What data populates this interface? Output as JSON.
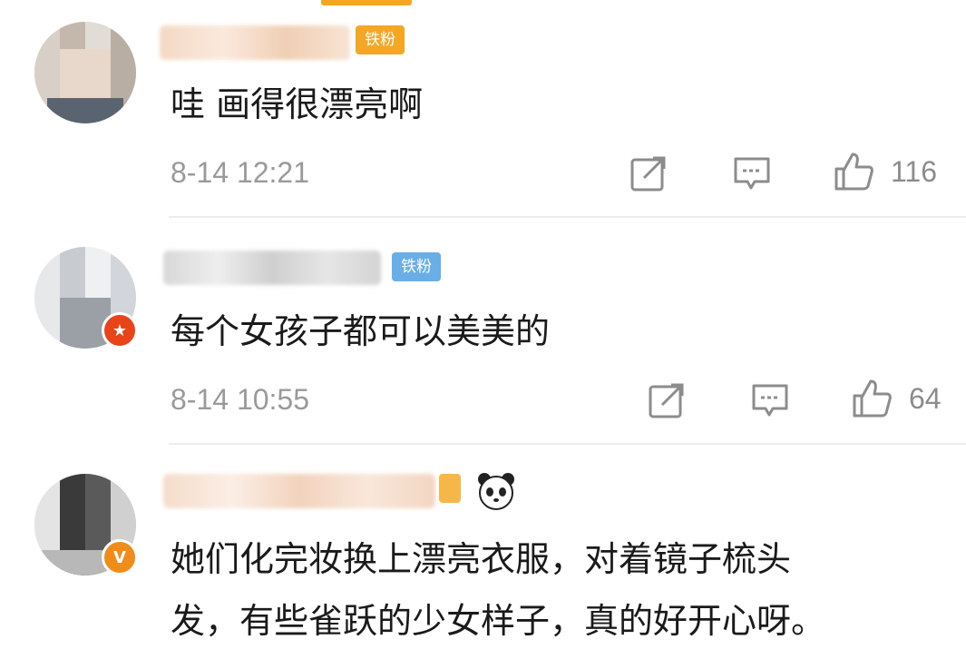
{
  "comments": [
    {
      "badge": "铁粉",
      "badge_color": "#f5a623",
      "text": "哇 画得很漂亮啊",
      "timestamp": "8-14 12:21",
      "likes": "116"
    },
    {
      "badge": "铁粉",
      "badge_color": "#6aaee8",
      "avatar_badge_icon": "star-badge-icon",
      "text": "每个女孩子都可以美美的",
      "timestamp": "8-14 10:55",
      "likes": "64"
    },
    {
      "avatar_badge": "V",
      "emoji_icon": "panda-icon",
      "text": "她们化完妆换上漂亮衣服，对着镜子梳头\n发，有些雀跃的少女样子，真的好开心呀。"
    }
  ],
  "colors": {
    "accent": "#f5a623",
    "verified": "#e8441a",
    "muted": "#8c8c8c"
  }
}
